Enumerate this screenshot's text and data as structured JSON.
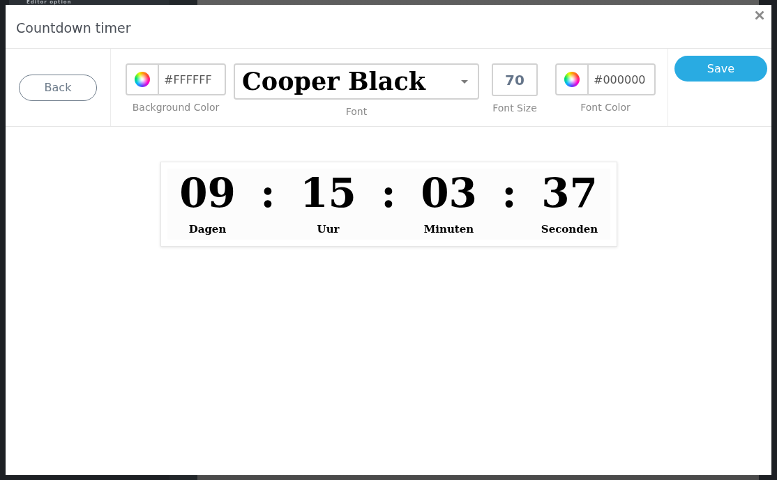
{
  "background": {
    "panel_title": "Editor option"
  },
  "dialog": {
    "title": "Countdown timer"
  },
  "toolbar": {
    "back_button": "Back",
    "fields": [
      {
        "kind": "color",
        "label": "Background Color",
        "value": "#FFFFFF"
      },
      {
        "kind": "font",
        "label": "Font",
        "value": "Cooper Black"
      },
      {
        "kind": "number",
        "label": "Font Size",
        "value": "70"
      },
      {
        "kind": "color",
        "label": "Font Color",
        "value": "#000000"
      }
    ],
    "save_button": "Save"
  },
  "timer": {
    "items": [
      {
        "kind": "unit",
        "value": "09",
        "label": "Dagen"
      },
      {
        "kind": "separator",
        "text": ":"
      },
      {
        "kind": "unit",
        "value": "15",
        "label": "Uur"
      },
      {
        "kind": "separator",
        "text": ":"
      },
      {
        "kind": "unit",
        "value": "03",
        "label": "Minuten"
      },
      {
        "kind": "separator",
        "text": ":"
      },
      {
        "kind": "unit",
        "value": "37",
        "label": "Seconden"
      }
    ]
  }
}
